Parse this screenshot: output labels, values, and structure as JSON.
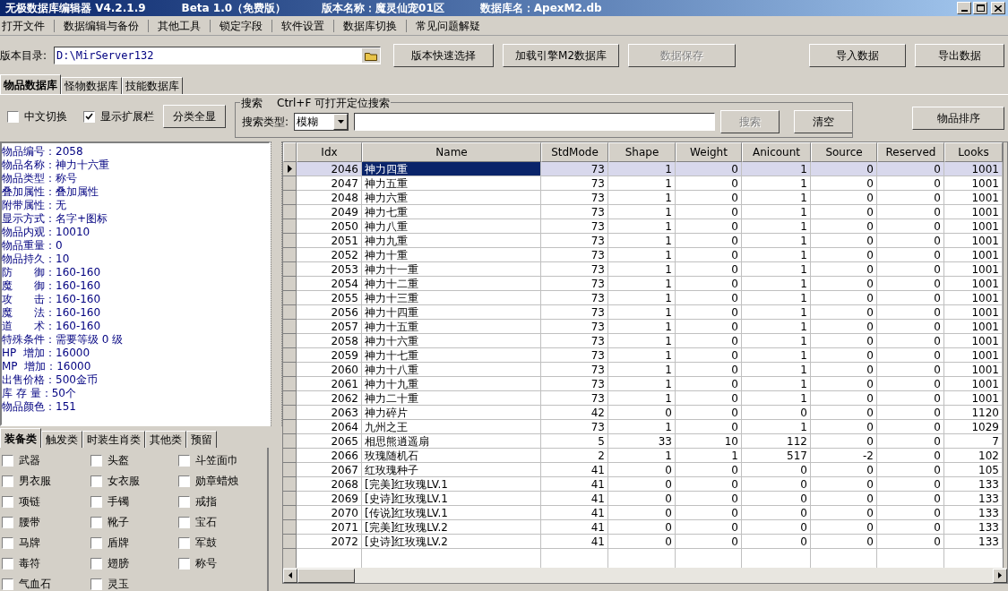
{
  "window": {
    "title_parts": [
      "无极数据库编辑器 V4.2.1.9",
      "Beta 1.0（免费版）",
      "版本名称：魔灵仙宠01区",
      "数据库名：ApexM2.db"
    ]
  },
  "menu": [
    "打开文件",
    "数据编辑与备份",
    "其他工具",
    "锁定字段",
    "软件设置",
    "数据库切换",
    "常见问题解疑"
  ],
  "toolbar": {
    "path_label": "版本目录:",
    "path_value": "D:\\MirServer132",
    "buttons": [
      {
        "label": "版本快速选择",
        "disabled": false
      },
      {
        "label": "加载引擎M2数据库",
        "disabled": false
      },
      {
        "label": "数据保存",
        "disabled": true
      },
      {
        "label": "导入数据",
        "disabled": false
      },
      {
        "label": "导出数据",
        "disabled": false
      }
    ]
  },
  "tabs": [
    {
      "label": "物品数据库",
      "selected": true
    },
    {
      "label": "怪物数据库",
      "selected": false
    },
    {
      "label": "技能数据库",
      "selected": false
    }
  ],
  "options": {
    "checkboxes": [
      {
        "label": "中文切换",
        "checked": false
      },
      {
        "label": "显示扩展栏",
        "checked": true
      }
    ],
    "button": "分类全显"
  },
  "search": {
    "title": "搜索",
    "hint": "Ctrl+F 可打开定位搜索",
    "type_label": "搜索类型:",
    "type_value": "模糊",
    "buttons": [
      {
        "label": "搜索",
        "disabled": true
      },
      {
        "label": "清空",
        "disabled": false
      }
    ]
  },
  "sort_button": "物品排序",
  "item_info": [
    "物品编号：2058",
    "物品名称：神力十六重",
    "物品类型：称号",
    "叠加属性：叠加属性",
    "附带属性：无",
    "显示方式：名字+图标",
    "物品内观：10010",
    "物品重量：0",
    "物品持久：10",
    "防　　御：160-160",
    "魔　　御：160-160",
    "攻　　击：160-160",
    "魔　　法：160-160",
    "道　　术：160-160",
    "特殊条件：需要等级 0 级",
    "HP  增加：16000",
    "MP  增加：16000",
    "出售价格：500金币",
    "库 存 量：50个",
    "物品颜色：151"
  ],
  "category_tabs": [
    {
      "label": "装备类",
      "selected": true
    },
    {
      "label": "触发类",
      "selected": false
    },
    {
      "label": "时装生肖类",
      "selected": false
    },
    {
      "label": "其他类",
      "selected": false
    },
    {
      "label": "预留",
      "selected": false
    }
  ],
  "categories": [
    {
      "label": "武器",
      "checked": false
    },
    {
      "label": "头盔",
      "checked": false
    },
    {
      "label": "斗笠面巾",
      "checked": false
    },
    {
      "label": "男衣服",
      "checked": false
    },
    {
      "label": "女衣服",
      "checked": false
    },
    {
      "label": "勋章蜡烛",
      "checked": false
    },
    {
      "label": "项链",
      "checked": false
    },
    {
      "label": "手镯",
      "checked": false
    },
    {
      "label": "戒指",
      "checked": false
    },
    {
      "label": "腰带",
      "checked": false
    },
    {
      "label": "靴子",
      "checked": false
    },
    {
      "label": "宝石",
      "checked": false
    },
    {
      "label": "马牌",
      "checked": false
    },
    {
      "label": "盾牌",
      "checked": false
    },
    {
      "label": "军鼓",
      "checked": false
    },
    {
      "label": "毒符",
      "checked": false
    },
    {
      "label": "翅膀",
      "checked": false
    },
    {
      "label": "称号",
      "checked": false
    },
    {
      "label": "气血石",
      "checked": false
    },
    {
      "label": "灵玉",
      "checked": false
    }
  ],
  "table": {
    "columns": [
      "Idx",
      "Name",
      "StdMode",
      "Shape",
      "Weight",
      "Anicount",
      "Source",
      "Reserved",
      "Looks"
    ],
    "rows": [
      {
        "selected": true,
        "cells": [
          "2046",
          "神力四重",
          "73",
          "1",
          "0",
          "1",
          "0",
          "0",
          "1001"
        ]
      },
      {
        "selected": false,
        "cells": [
          "2047",
          "神力五重",
          "73",
          "1",
          "0",
          "1",
          "0",
          "0",
          "1001"
        ]
      },
      {
        "selected": false,
        "cells": [
          "2048",
          "神力六重",
          "73",
          "1",
          "0",
          "1",
          "0",
          "0",
          "1001"
        ]
      },
      {
        "selected": false,
        "cells": [
          "2049",
          "神力七重",
          "73",
          "1",
          "0",
          "1",
          "0",
          "0",
          "1001"
        ]
      },
      {
        "selected": false,
        "cells": [
          "2050",
          "神力八重",
          "73",
          "1",
          "0",
          "1",
          "0",
          "0",
          "1001"
        ]
      },
      {
        "selected": false,
        "cells": [
          "2051",
          "神力九重",
          "73",
          "1",
          "0",
          "1",
          "0",
          "0",
          "1001"
        ]
      },
      {
        "selected": false,
        "cells": [
          "2052",
          "神力十重",
          "73",
          "1",
          "0",
          "1",
          "0",
          "0",
          "1001"
        ]
      },
      {
        "selected": false,
        "cells": [
          "2053",
          "神力十一重",
          "73",
          "1",
          "0",
          "1",
          "0",
          "0",
          "1001"
        ]
      },
      {
        "selected": false,
        "cells": [
          "2054",
          "神力十二重",
          "73",
          "1",
          "0",
          "1",
          "0",
          "0",
          "1001"
        ]
      },
      {
        "selected": false,
        "cells": [
          "2055",
          "神力十三重",
          "73",
          "1",
          "0",
          "1",
          "0",
          "0",
          "1001"
        ]
      },
      {
        "selected": false,
        "cells": [
          "2056",
          "神力十四重",
          "73",
          "1",
          "0",
          "1",
          "0",
          "0",
          "1001"
        ]
      },
      {
        "selected": false,
        "cells": [
          "2057",
          "神力十五重",
          "73",
          "1",
          "0",
          "1",
          "0",
          "0",
          "1001"
        ]
      },
      {
        "selected": false,
        "cells": [
          "2058",
          "神力十六重",
          "73",
          "1",
          "0",
          "1",
          "0",
          "0",
          "1001"
        ]
      },
      {
        "selected": false,
        "cells": [
          "2059",
          "神力十七重",
          "73",
          "1",
          "0",
          "1",
          "0",
          "0",
          "1001"
        ]
      },
      {
        "selected": false,
        "cells": [
          "2060",
          "神力十八重",
          "73",
          "1",
          "0",
          "1",
          "0",
          "0",
          "1001"
        ]
      },
      {
        "selected": false,
        "cells": [
          "2061",
          "神力十九重",
          "73",
          "1",
          "0",
          "1",
          "0",
          "0",
          "1001"
        ]
      },
      {
        "selected": false,
        "cells": [
          "2062",
          "神力二十重",
          "73",
          "1",
          "0",
          "1",
          "0",
          "0",
          "1001"
        ]
      },
      {
        "selected": false,
        "cells": [
          "2063",
          "神力碎片",
          "42",
          "0",
          "0",
          "0",
          "0",
          "0",
          "1120"
        ]
      },
      {
        "selected": false,
        "cells": [
          "2064",
          "九州之王",
          "73",
          "1",
          "0",
          "1",
          "0",
          "0",
          "1029"
        ]
      },
      {
        "selected": false,
        "cells": [
          "2065",
          "相思熊逍遥扇",
          "5",
          "33",
          "10",
          "112",
          "0",
          "0",
          "7"
        ]
      },
      {
        "selected": false,
        "cells": [
          "2066",
          "玫瑰随机石",
          "2",
          "1",
          "1",
          "517",
          "-2",
          "0",
          "102"
        ]
      },
      {
        "selected": false,
        "cells": [
          "2067",
          "红玫瑰种子",
          "41",
          "0",
          "0",
          "0",
          "0",
          "0",
          "105"
        ]
      },
      {
        "selected": false,
        "cells": [
          "2068",
          "[完美]红玫瑰LV.1",
          "41",
          "0",
          "0",
          "0",
          "0",
          "0",
          "133"
        ]
      },
      {
        "selected": false,
        "cells": [
          "2069",
          "[史诗]红玫瑰LV.1",
          "41",
          "0",
          "0",
          "0",
          "0",
          "0",
          "133"
        ]
      },
      {
        "selected": false,
        "cells": [
          "2070",
          "[传说]红玫瑰LV.1",
          "41",
          "0",
          "0",
          "0",
          "0",
          "0",
          "133"
        ]
      },
      {
        "selected": false,
        "cells": [
          "2071",
          "[完美]红玫瑰LV.2",
          "41",
          "0",
          "0",
          "0",
          "0",
          "0",
          "133"
        ]
      },
      {
        "selected": false,
        "cells": [
          "2072",
          "[史诗]红玫瑰LV.2",
          "41",
          "0",
          "0",
          "0",
          "0",
          "0",
          "133"
        ]
      }
    ]
  }
}
